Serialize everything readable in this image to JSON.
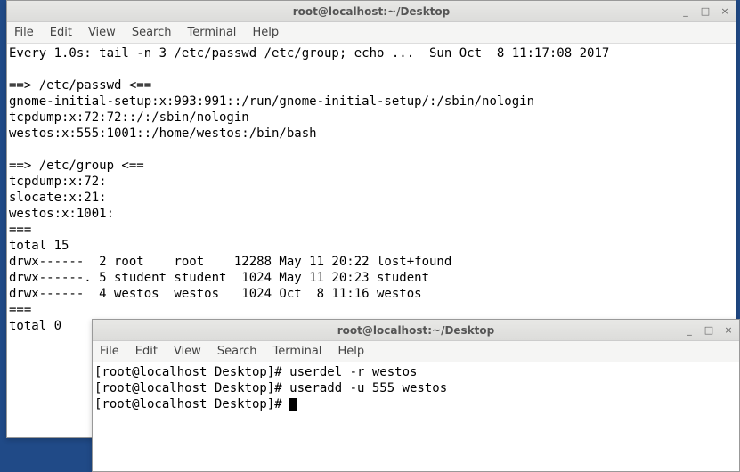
{
  "win1": {
    "title": "root@localhost:~/Desktop",
    "controls": {
      "min": "_",
      "max": "□",
      "close": "×"
    },
    "menu": [
      "File",
      "Edit",
      "View",
      "Search",
      "Terminal",
      "Help"
    ],
    "lines": [
      "Every 1.0s: tail -n 3 /etc/passwd /etc/group; echo ...  Sun Oct  8 11:17:08 2017",
      "",
      "==> /etc/passwd <==",
      "gnome-initial-setup:x:993:991::/run/gnome-initial-setup/:/sbin/nologin",
      "tcpdump:x:72:72::/:/sbin/nologin",
      "westos:x:555:1001::/home/westos:/bin/bash",
      "",
      "==> /etc/group <==",
      "tcpdump:x:72:",
      "slocate:x:21:",
      "westos:x:1001:",
      "===",
      "total 15",
      "drwx------  2 root    root    12288 May 11 20:22 lost+found",
      "drwx------. 5 student student  1024 May 11 20:23 student",
      "drwx------  4 westos  westos   1024 Oct  8 11:16 westos",
      "===",
      "total 0"
    ]
  },
  "win2": {
    "title": "root@localhost:~/Desktop",
    "controls": {
      "min": "_",
      "max": "□",
      "close": "×"
    },
    "menu": [
      "File",
      "Edit",
      "View",
      "Search",
      "Terminal",
      "Help"
    ],
    "lines": [
      "[root@localhost Desktop]# userdel -r westos",
      "[root@localhost Desktop]# useradd -u 555 westos",
      "[root@localhost Desktop]# "
    ]
  }
}
